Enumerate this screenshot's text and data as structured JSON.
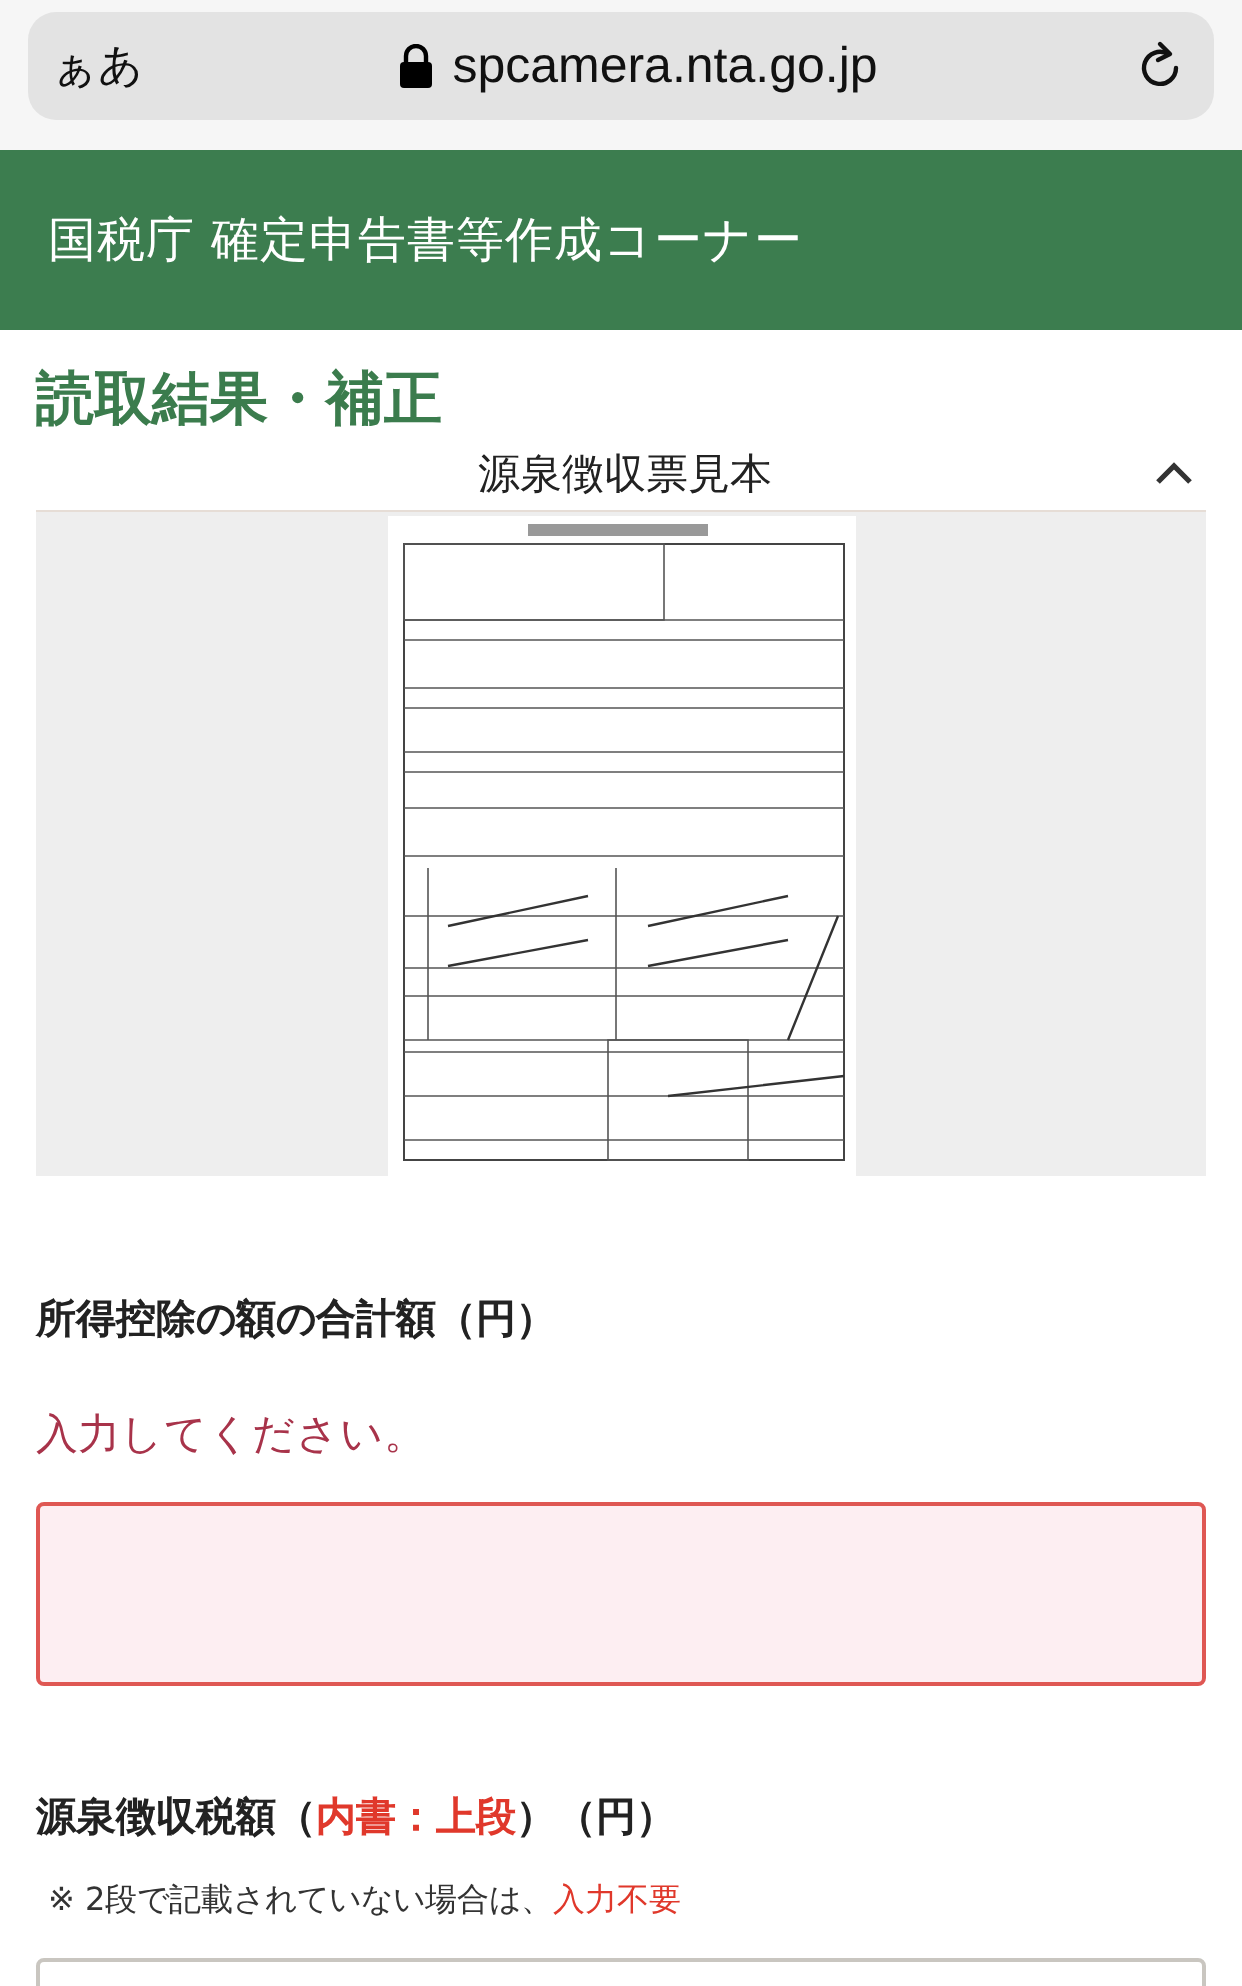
{
  "browser_bar": {
    "text_size_button": "ぁあ",
    "address": "spcamera.nta.go.jp"
  },
  "header": {
    "title": "国税庁 確定申告書等作成コーナー"
  },
  "page_title": "読取結果・補正",
  "sample_panel": {
    "title": "源泉徴収票見本",
    "expanded": true
  },
  "fields": [
    {
      "label": [
        {
          "text": "所得控除の額の合計額（円）",
          "emphasis": false
        }
      ],
      "error": "入力してください。",
      "invalid": true
    },
    {
      "label": [
        {
          "text": "源泉徴収税額（",
          "emphasis": false
        },
        {
          "text": "内書：上段",
          "emphasis": true
        },
        {
          "text": "）（円）",
          "emphasis": false
        }
      ],
      "note": [
        {
          "text": "※ 2段で記載されていない場合は、",
          "emphasis": false
        },
        {
          "text": "入力不要",
          "emphasis": true
        }
      ],
      "invalid": false
    }
  ]
}
